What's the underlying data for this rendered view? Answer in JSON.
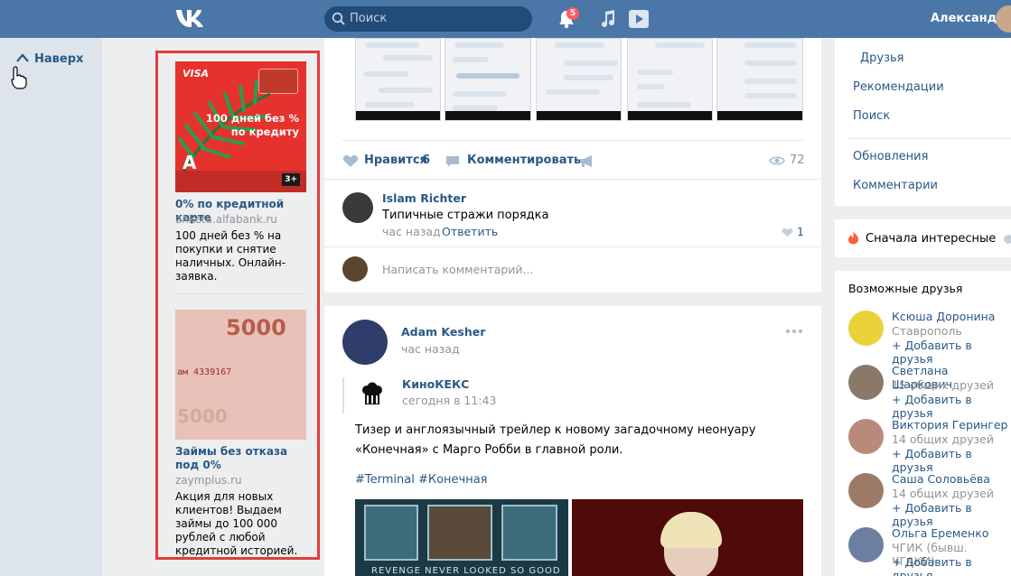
{
  "header": {
    "search_placeholder": "Поиск",
    "notifications_count": "5",
    "user_name": "Александр",
    "accent_color": "#4a76a8"
  },
  "left": {
    "up_label": "Наверх"
  },
  "ads": [
    {
      "image_text": {
        "brand": "VISA",
        "headline_line1": "100 дней без %",
        "headline_line2": "по кредиту",
        "bank_letter": "А",
        "age": "3+"
      },
      "title": "0% по кредитной карте",
      "domain": "anketa.alfabank.ru",
      "text": "100 дней без % на покупки и снятие наличных. Онлайн-заявка."
    },
    {
      "image_text": {
        "denomination": "5000",
        "serial": "ам 4339167"
      },
      "title": "Займы без отказа под 0%",
      "domain": "zaymplus.ru",
      "text": "Акция для новых клиентов! Выдаем займы до 100 000 рублей с любой кредитной историей."
    }
  ],
  "post1": {
    "like_label": "Нравится",
    "like_count": "6",
    "comment_label": "Комментировать",
    "views": "72",
    "comment": {
      "author": "Islam Richter",
      "text": "Типичные стражи порядка",
      "time": "час назад",
      "reply_label": "Ответить",
      "likes": "1"
    },
    "write_placeholder": "Написать комментарий..."
  },
  "post2": {
    "author": "Adam Kesher",
    "time": "час назад",
    "repost_source": "КиноКЕКС",
    "repost_time": "сегодня в 11:43",
    "text": "Тизер и англоязычный трейлер к новому загадочному неонуару «Конечная» с Марго Робби в главной роли.",
    "hashtags": "#Terminal #Конечная",
    "image_tagline": "REVENGE NEVER LOOKED SO GOOD"
  },
  "right_nav": {
    "items": [
      "Друзья",
      "Рекомендации",
      "Поиск"
    ],
    "items2": [
      "Обновления",
      "Комментарии"
    ],
    "sort_label": "Сначала интересные"
  },
  "possible_friends": {
    "title": "Возможные друзья",
    "add_label": "+ Добавить в друзья",
    "people": [
      {
        "name": "Ксюша Доронина",
        "sub": "Ставрополь"
      },
      {
        "name": "Светлана Шаркович",
        "sub": "15 общих друзей"
      },
      {
        "name": "Виктория Герингер",
        "sub": "14 общих друзей"
      },
      {
        "name": "Саша Соловьёва",
        "sub": "14 общих друзей"
      },
      {
        "name": "Ольга Еременко",
        "sub": "ЧГИК (бывш. ЧГАКИ)"
      }
    ]
  }
}
